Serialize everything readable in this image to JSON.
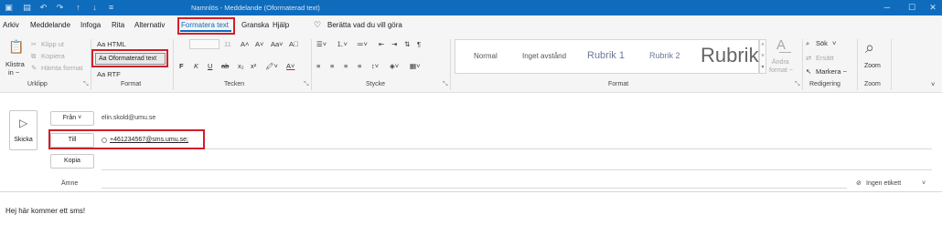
{
  "titlebar": {
    "title": "Namnlös  -  Meddelande (Oformaterad text)",
    "icons": [
      "app-icon",
      "save-icon",
      "undo-icon",
      "redo-icon",
      "up-icon",
      "down-icon",
      "more-icon"
    ],
    "bg_color": "#0f6cbd"
  },
  "menu": {
    "items": [
      "Arkiv",
      "Meddelande",
      "Infoga",
      "Rita",
      "Alternativ",
      "Formatera text",
      "Granska",
      "Hjälp",
      "Berätta vad du vill göra"
    ],
    "active_index": 5,
    "accent_color": "#0f6cbd",
    "highlight_color": "#d21f2b"
  },
  "ribbon": {
    "clipboard": {
      "paste_label": "Klistra",
      "paste_sub": "in ~",
      "cut": "Klipp ut",
      "copy": "Kopiera",
      "format_painter": "Hämta format",
      "group": "Urklipp"
    },
    "format": {
      "html": "Aa HTML",
      "plain": "Aa Oformaterad text",
      "rtf": "Aa RTF",
      "group": "Format"
    },
    "font": {
      "size": "11",
      "group": "Tecken",
      "buttons": [
        "F",
        "K",
        "U",
        "ab",
        "x₂",
        "x²"
      ]
    },
    "paragraph": {
      "group": "Stycke"
    },
    "styles": {
      "items": [
        "Normal",
        "Inget avstånd",
        "Rubrik 1",
        "Rubrik 2",
        "Rubrik"
      ],
      "change": "Ändra",
      "change_sub": "format ~",
      "group": "Format"
    },
    "editing": {
      "search": "Sök",
      "replace": "Ersätt",
      "select": "Markera ~",
      "group": "Redigering"
    },
    "zoom": {
      "label": "Zoom",
      "group": "Zoom"
    }
  },
  "compose": {
    "send_label": "Skicka",
    "from_label": "Från",
    "from_value": "elin.skold@umu.se",
    "to_label": "Till",
    "to_value": "+461234567@sms.umu.se;",
    "cc_label": "Kopia",
    "subject_label": "Ämne",
    "sensitivity": "Ingen etikett",
    "body": "Hej här kommer ett sms!"
  }
}
